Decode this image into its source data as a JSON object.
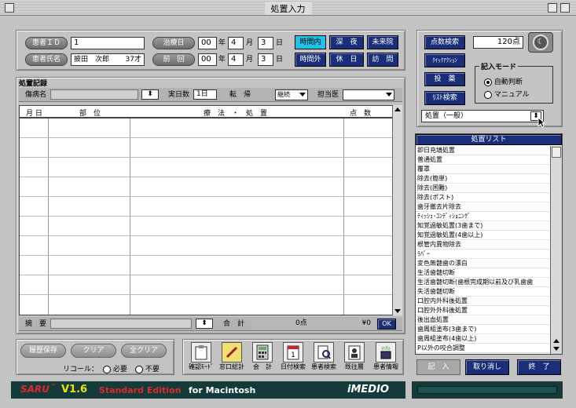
{
  "window": {
    "title": "処置入力"
  },
  "patient": {
    "id_label": "患者ＩＤ",
    "id_value": "1",
    "name_label": "患者氏名",
    "name_value": "披田　次郎",
    "age": "37才",
    "treat_date_label": "治療日",
    "treat_y": "00",
    "treat_m": "4",
    "treat_d": "3",
    "prev_label": "前　回",
    "prev_y": "00",
    "prev_m": "4",
    "prev_d": "3",
    "year_unit": "年",
    "month_unit": "月",
    "day_unit": "日"
  },
  "time_buttons": [
    "時間内",
    "深　夜",
    "未来院",
    "時間外",
    "休　日",
    "訪　問"
  ],
  "record": {
    "title": "処置記録",
    "disease_label": "傷病名",
    "days_label": "実日数",
    "days_value": "1日",
    "tenki_label": "転　帰",
    "tenki_value": "継続",
    "doctor_label": "担当医",
    "col_date": "月 日",
    "col_part": "部　位",
    "col_method": "療　法　・　処　置",
    "col_points": "点　数",
    "summary_label": "摘　要",
    "total_label": "合　計",
    "total_points": "0点",
    "total_yen": "¥0",
    "ok_label": "OK"
  },
  "right": {
    "btn_score": "点数検索",
    "points_value": "120点",
    "btn_quick": "ｸｲｯｸｱｸｼｮﾝ",
    "btn_set": "投　薬",
    "btn_list": "ﾘｽﾄ検索",
    "mode_title": "記入モード",
    "mode_auto": "自動判断",
    "mode_manual": "マニュアル",
    "category_value": "処置（一般）"
  },
  "list": {
    "title": "処置リスト",
    "items": [
      "即日充填処置",
      "普通処置",
      "覆罩",
      "除去(簡単)",
      "除去(困難)",
      "除去(ポスト)",
      "歯牙撤去片除去",
      "ﾃｨｯｼｭ･ｺﾝﾃﾞｨｼｮﾆﾝｸﾞ",
      "知覚過敏処置(3歯まで)",
      "知覚過敏処置(4歯以上)",
      "根管内異物除去",
      "ﾗﾊﾞｰ",
      "変色無髄歯の漂白",
      "生活歯髄切断",
      "生活歯髄切断(歯根完成期以前及び乳歯歯",
      "失活歯髄切断",
      "口腔内外科後処置",
      "口腔外外科後処置",
      "後出血処置",
      "歯周組塗布(3歯まで)",
      "歯周組塗布(4歯以上)",
      "P以外の咬合調整"
    ]
  },
  "bottom": {
    "btn_history": "履歴保存",
    "btn_clear": "クリア",
    "btn_allclear": "全クリア",
    "recall_label": "リコール：",
    "recall_need": "必要",
    "recall_none": "不要",
    "tools": [
      {
        "label": "確認ﾓｰﾄﾞ",
        "icon": "clipboard-icon"
      },
      {
        "label": "窓口総計",
        "icon": "pencil-icon"
      },
      {
        "label": "会　計",
        "icon": "calculator-icon"
      },
      {
        "label": "日付検索",
        "icon": "calendar-icon"
      },
      {
        "label": "患者検索",
        "icon": "patient-search-icon"
      },
      {
        "label": "既往層",
        "icon": "history-icon"
      },
      {
        "label": "患者情報",
        "icon": "info-icon"
      }
    ],
    "btn_enter": "記　入",
    "btn_cancel": "取り消し",
    "btn_end": "終　了"
  },
  "footer": {
    "logo": "SARU",
    "tm": "™",
    "version": "V1.6",
    "edition": "Standard Edition",
    "platform": "for Macintosh",
    "brand": "iMEDIO"
  },
  "colors": {
    "navy": "#1a2f7a",
    "cyan": "#20c0e8",
    "footer_bg": "#143a3a",
    "version_yellow": "#e8e800",
    "edition_red": "#e02a2a"
  }
}
